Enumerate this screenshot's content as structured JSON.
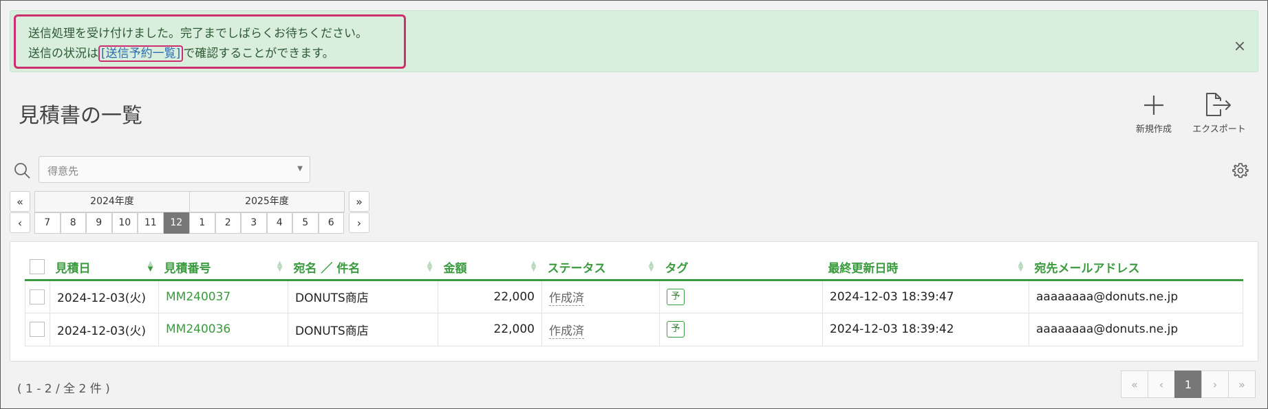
{
  "alert": {
    "line1": "送信処理を受け付けました。完了までしばらくお待ちください。",
    "line2_prefix": "送信の状況は",
    "link": "[送信予約一覧]",
    "line2_suffix": "で確認することができます。",
    "close": "×"
  },
  "page": {
    "title": "見積書の一覧",
    "new_label": "新規作成",
    "export_label": "エクスポート"
  },
  "filter": {
    "customer_placeholder": "得意先"
  },
  "period": {
    "first": "«",
    "prev": "‹",
    "next": "›",
    "last": "»",
    "years": [
      "2024年度",
      "2025年度"
    ],
    "months": [
      "7",
      "8",
      "9",
      "10",
      "11",
      "12",
      "1",
      "2",
      "3",
      "4",
      "5",
      "6"
    ],
    "active_month": "12"
  },
  "table": {
    "headers": [
      "見積日",
      "見積番号",
      "宛名 ／ 件名",
      "金額",
      "ステータス",
      "タグ",
      "最終更新日時",
      "宛先メールアドレス"
    ],
    "rows": [
      {
        "date": "2024-12-03(火)",
        "number": "MM240037",
        "name": "DONUTS商店",
        "amount": "22,000",
        "status": "作成済",
        "tag": "予",
        "updated": "2024-12-03 18:39:47",
        "email": "aaaaaaaa@donuts.ne.jp"
      },
      {
        "date": "2024-12-03(火)",
        "number": "MM240036",
        "name": "DONUTS商店",
        "amount": "22,000",
        "status": "作成済",
        "tag": "予",
        "updated": "2024-12-03 18:39:42",
        "email": "aaaaaaaa@donuts.ne.jp"
      }
    ]
  },
  "footer": {
    "count": "( 1 - 2 / 全 2 件 )",
    "pager": [
      "«",
      "‹",
      "1",
      "›",
      "»"
    ],
    "current_page": "1"
  },
  "icons": {
    "plus": "plus-icon",
    "export": "export-icon",
    "search": "search-icon",
    "gear": "gear-icon",
    "close": "close-icon"
  },
  "colors": {
    "accent_green": "#3a9a3e",
    "alert_bg": "#d9eedd",
    "highlight": "#cc2e6e",
    "link": "#2a6db3",
    "active_cell": "#777777"
  }
}
